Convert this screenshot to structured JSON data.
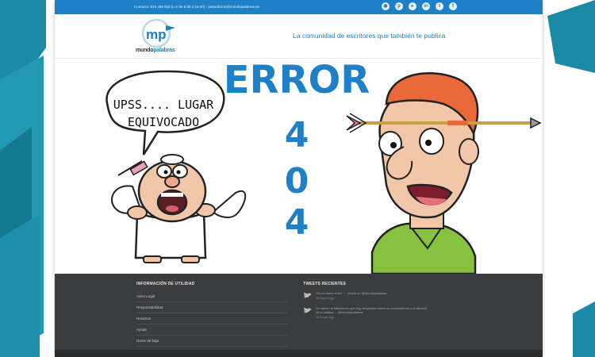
{
  "topbar": {
    "contact": "Contacto: 615 396 932 (L-V de 8:30 a 16:30) - autoedicion@mundopalabras.es",
    "social_icons": [
      "rss-icon",
      "pinterest-icon",
      "youtube-icon",
      "linkedin-icon",
      "twitter-icon",
      "facebook-icon"
    ]
  },
  "header": {
    "logo_mark": "mp",
    "brand_part1": "mundo",
    "brand_part2": "palabras",
    "tagline": "La comunidad de escritores que también te publica"
  },
  "error_art": {
    "speech_line1": "UPSS.... LUGAR",
    "speech_line2": "EQUIVOCADO",
    "error_word": "ERROR",
    "digit_1": "4",
    "digit_2": "0",
    "digit_3": "4"
  },
  "footer": {
    "info_heading": "INFORMACIÓN DE UTILIDAD",
    "info_links": [
      "Aviso Legal",
      "Responsabilidad",
      "Nosotros",
      "Ayuda",
      "Darse de baja"
    ],
    "tweets_heading": "TWEETS RECIENTES",
    "tweets": [
      {
        "text": "\"En un buen orden\" ... ebook en @mundopalabras",
        "time": "10 hours ago"
      },
      {
        "text": "Ya vienen al bibliotecas que hoy despiertan sobre su conocimiento y la difusión",
        "text2": "de la calidad ... @mundopalabras",
        "time": "11 hours ago"
      }
    ]
  },
  "colors": {
    "brand_blue": "#1e80c8",
    "footer_dark": "#3b3c3e",
    "bg_teal": "#1a8aa6"
  }
}
